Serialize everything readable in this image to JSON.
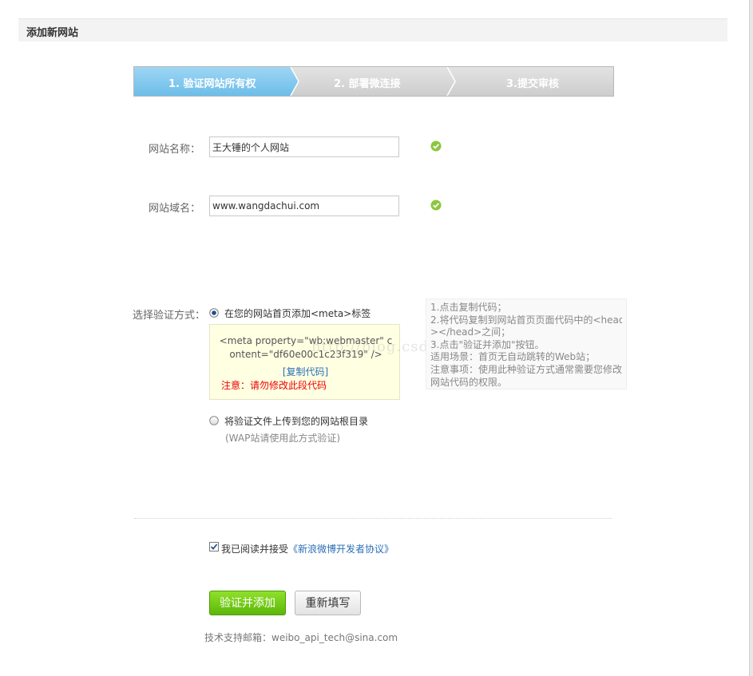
{
  "header": {
    "title": "添加新网站"
  },
  "steps": [
    {
      "label": "1. 验证网站所有权",
      "active": true
    },
    {
      "label": "2. 部署微连接",
      "active": false
    },
    {
      "label": "3.提交审核",
      "active": false
    }
  ],
  "form": {
    "site_name": {
      "label": "网站名称：",
      "value": "王大锤的个人网站",
      "status_icon": "check-circle-icon"
    },
    "site_domain": {
      "label": "网站域名：",
      "value": "www.wangdachui.com",
      "status_icon": "check-circle-icon"
    }
  },
  "verify": {
    "label": "选择验证方式：",
    "option_meta": {
      "label": "在您的网站首页添加<meta>标签",
      "selected": true
    },
    "meta_code": "<meta property=\"wb:webmaster\" content=\"df60e00c1c23f319\" />",
    "copy_link": "[复制代码]",
    "warning": "注意：请勿修改此段代码",
    "option_file": {
      "label": "将验证文件上传到您的网站根目录",
      "selected": false
    },
    "file_hint": "(WAP站请使用此方式验证)"
  },
  "help": [
    "1.点击复制代码；",
    "2.将代码复制到网站首页页面代码中的<head",
    "></head>之间；",
    "3.点击\"验证并添加\"按钮。",
    "适用场景：首页无自动跳转的Web站；",
    "注意事项：使用此种验证方式通常需要您修改",
    "网站代码的权限。"
  ],
  "agreement": {
    "checked": true,
    "text": "我已阅读并接受",
    "link": "《新浪微博开发者协议》"
  },
  "buttons": {
    "submit": "验证并添加",
    "reset": "重新填写"
  },
  "support": "技术支持邮箱：weibo_api_tech@sina.com",
  "watermark": "http://blog.csdn.",
  "colors": {
    "step_active": "#7fc6ee",
    "step_inactive": "#d9d9d9",
    "accent_green": "#6cc814",
    "link_blue": "#2a6fb6",
    "warning_red": "#ee0000"
  }
}
